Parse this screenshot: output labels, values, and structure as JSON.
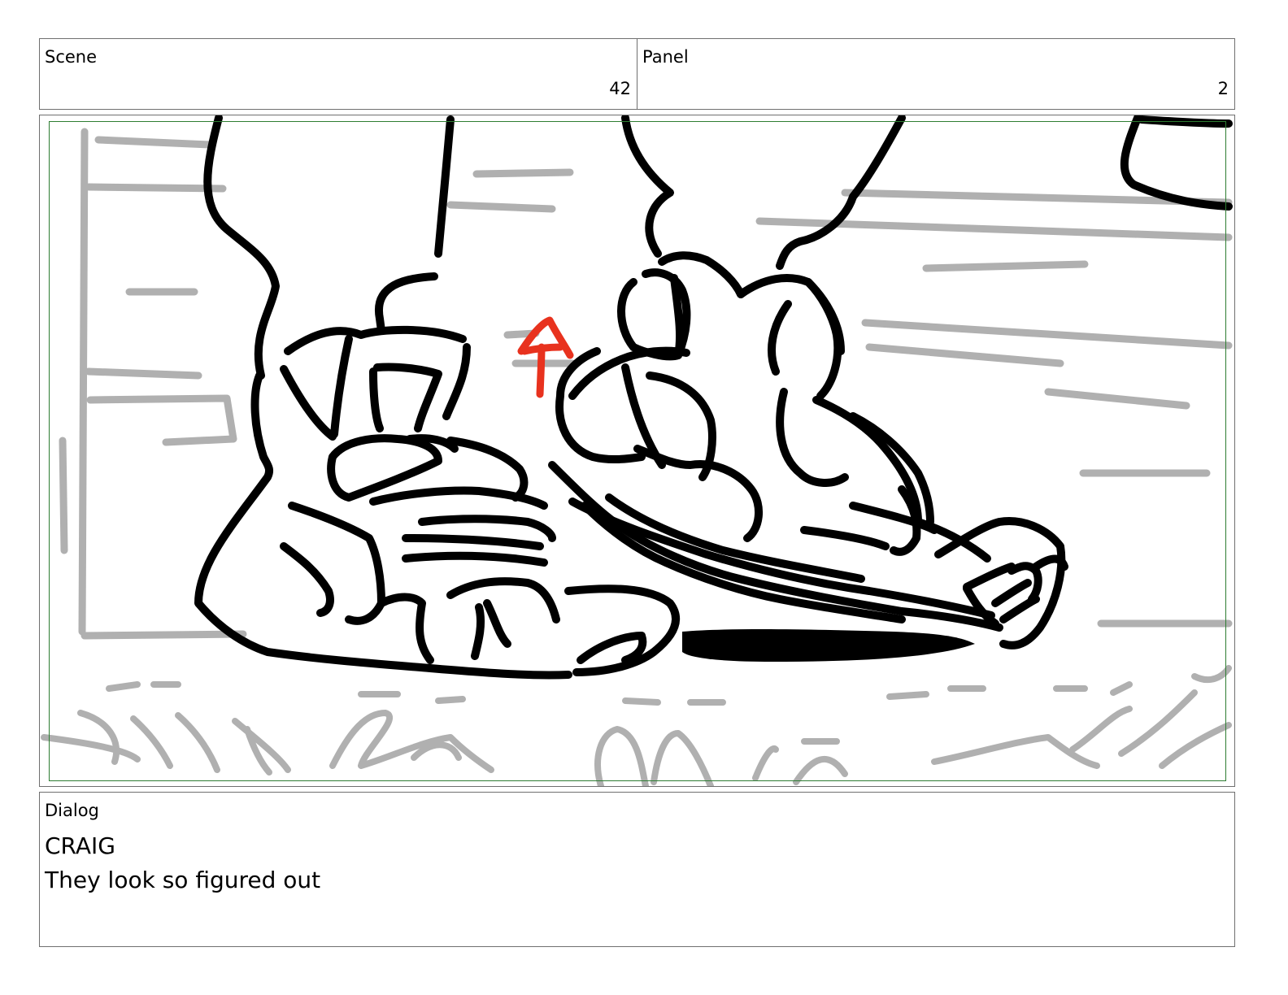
{
  "header": {
    "scene_label": "Scene",
    "scene_number": "42",
    "panel_label": "Panel",
    "panel_number": "2"
  },
  "dialog": {
    "label": "Dialog",
    "speaker": "CRAIG",
    "line": "They look so figured out"
  },
  "colors": {
    "ink": "#000000",
    "background_sketch": "#b0b0b0",
    "annotation_arrow": "#e8321e",
    "safe_area_border": "#2e7d32",
    "frame_border": "#6f6f6f"
  }
}
